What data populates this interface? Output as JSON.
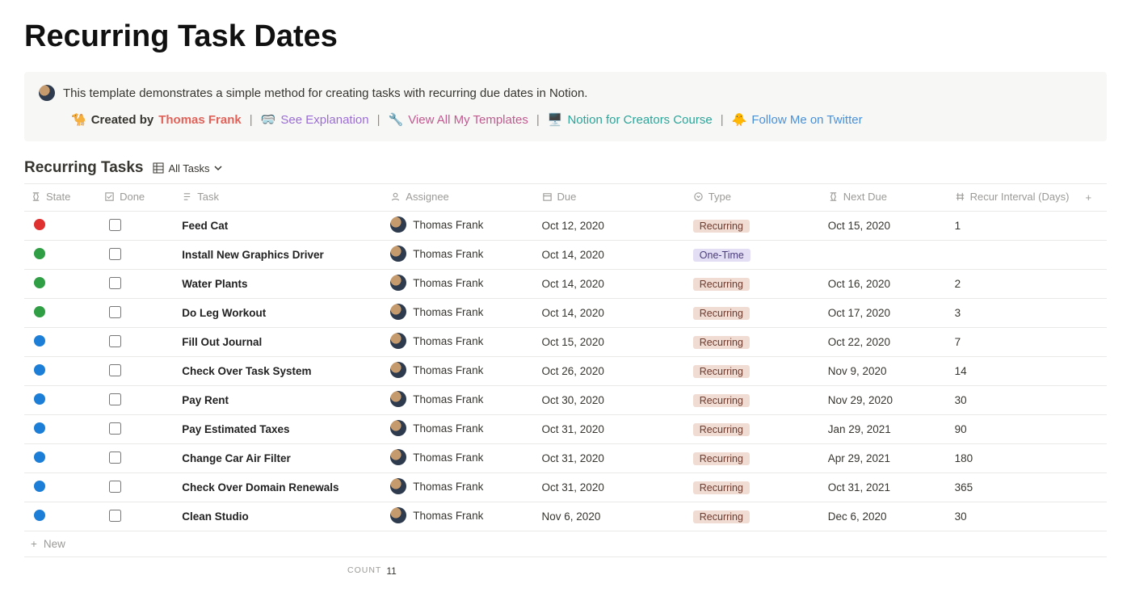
{
  "page_title": "Recurring Task Dates",
  "callout": {
    "description": "This template demonstrates a simple method for creating tasks with recurring due dates in Notion.",
    "created_by_label": "Created by",
    "author": "Thomas Frank",
    "links": {
      "explanation": "See Explanation",
      "templates": "View All My Templates",
      "creators": "Notion for Creators Course",
      "twitter": "Follow Me on Twitter"
    },
    "emojis": {
      "camel": "🐪",
      "goggles": "🥽",
      "wrench": "🔧",
      "monitor": "🖥️",
      "bird": "🐥"
    }
  },
  "database": {
    "title": "Recurring Tasks",
    "view_label": "All Tasks",
    "columns": {
      "state": "State",
      "done": "Done",
      "task": "Task",
      "assignee": "Assignee",
      "due": "Due",
      "type": "Type",
      "next_due": "Next Due",
      "interval": "Recur Interval (Days)"
    },
    "rows": [
      {
        "state": "red",
        "task": "Feed Cat",
        "assignee": "Thomas Frank",
        "due": "Oct 12, 2020",
        "type": "Recurring",
        "next_due": "Oct 15, 2020",
        "interval": "1"
      },
      {
        "state": "green",
        "task": "Install New Graphics Driver",
        "assignee": "Thomas Frank",
        "due": "Oct 14, 2020",
        "type": "One-Time",
        "next_due": "",
        "interval": ""
      },
      {
        "state": "green",
        "task": "Water Plants",
        "assignee": "Thomas Frank",
        "due": "Oct 14, 2020",
        "type": "Recurring",
        "next_due": "Oct 16, 2020",
        "interval": "2"
      },
      {
        "state": "green",
        "task": "Do Leg Workout",
        "assignee": "Thomas Frank",
        "due": "Oct 14, 2020",
        "type": "Recurring",
        "next_due": "Oct 17, 2020",
        "interval": "3"
      },
      {
        "state": "blue",
        "task": "Fill Out Journal",
        "assignee": "Thomas Frank",
        "due": "Oct 15, 2020",
        "type": "Recurring",
        "next_due": "Oct 22, 2020",
        "interval": "7"
      },
      {
        "state": "blue",
        "task": "Check Over Task System",
        "assignee": "Thomas Frank",
        "due": "Oct 26, 2020",
        "type": "Recurring",
        "next_due": "Nov 9, 2020",
        "interval": "14"
      },
      {
        "state": "blue",
        "task": "Pay Rent",
        "assignee": "Thomas Frank",
        "due": "Oct 30, 2020",
        "type": "Recurring",
        "next_due": "Nov 29, 2020",
        "interval": "30"
      },
      {
        "state": "blue",
        "task": "Pay Estimated Taxes",
        "assignee": "Thomas Frank",
        "due": "Oct 31, 2020",
        "type": "Recurring",
        "next_due": "Jan 29, 2021",
        "interval": "90"
      },
      {
        "state": "blue",
        "task": "Change Car Air Filter",
        "assignee": "Thomas Frank",
        "due": "Oct 31, 2020",
        "type": "Recurring",
        "next_due": "Apr 29, 2021",
        "interval": "180"
      },
      {
        "state": "blue",
        "task": "Check Over Domain Renewals",
        "assignee": "Thomas Frank",
        "due": "Oct 31, 2020",
        "type": "Recurring",
        "next_due": "Oct 31, 2021",
        "interval": "365"
      },
      {
        "state": "blue",
        "task": "Clean Studio",
        "assignee": "Thomas Frank",
        "due": "Nov 6, 2020",
        "type": "Recurring",
        "next_due": "Dec 6, 2020",
        "interval": "30"
      }
    ],
    "new_label": "New",
    "count_label": "COUNT",
    "count_value": "11"
  }
}
